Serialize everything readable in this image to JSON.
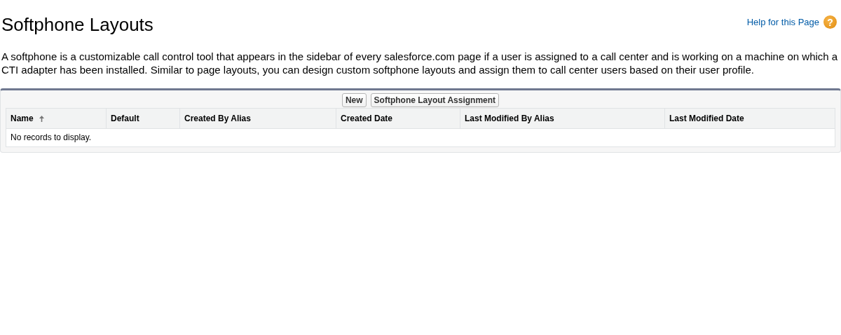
{
  "title": "Softphone Layouts",
  "help": {
    "label": "Help for this Page",
    "icon": "?"
  },
  "description": "A softphone is a customizable call control tool that appears in the sidebar of every salesforce.com page if a user is assigned to a call center and is working on a machine on which a CTI adapter has been installed. Similar to page layouts, you can design custom softphone layouts and assign them to call center users based on their user profile.",
  "buttons": [
    "New",
    "Softphone Layout Assignment"
  ],
  "table": {
    "columns": [
      {
        "label": "Name",
        "sorted": true
      },
      {
        "label": "Default",
        "sorted": false
      },
      {
        "label": "Created By Alias",
        "sorted": false
      },
      {
        "label": "Created Date",
        "sorted": false
      },
      {
        "label": "Last Modified By Alias",
        "sorted": false
      },
      {
        "label": "Last Modified Date",
        "sorted": false
      }
    ],
    "empty_message": "No records to display."
  }
}
